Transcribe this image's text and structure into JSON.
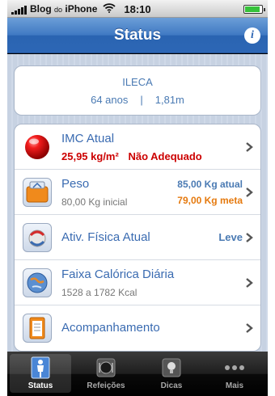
{
  "statusbar": {
    "carrier": "Blog",
    "carrier_small": "do",
    "carrier_rest": "iPhone",
    "time": "18:10",
    "battery_level": 0.9
  },
  "navbar": {
    "title": "Status",
    "info_label": "i"
  },
  "user": {
    "name": "ILECA",
    "age": "64 anos",
    "separator": "|",
    "height": "1,81m"
  },
  "rows": [
    {
      "title": "IMC Atual",
      "value": "25,95 kg/m²",
      "status": "Não Adequado",
      "status_color": "#cc0000",
      "value_color": "#cc0000"
    },
    {
      "title": "Peso",
      "sub": "80,00 Kg inicial",
      "current": "85,00 Kg atual",
      "goal": "79,00 Kg meta",
      "current_color": "#4a7ab3",
      "goal_color": "#e57a0f",
      "sub_color": "#777777"
    },
    {
      "title": "Ativ. Física Atual",
      "level": "Leve",
      "level_color": "#4a7ab3"
    },
    {
      "title": "Faixa Calórica Diária",
      "sub": "1528 a 1782 Kcal",
      "sub_color": "#777777"
    },
    {
      "title": "Acompanhamento"
    }
  ],
  "tabs": [
    {
      "label": "Status",
      "icon": "person-icon",
      "active": true
    },
    {
      "label": "Refeições",
      "icon": "plate-icon",
      "active": false
    },
    {
      "label": "Dicas",
      "icon": "lightbulb-icon",
      "active": false
    },
    {
      "label": "Mais",
      "icon": "more-dots-icon",
      "active": false
    }
  ],
  "colors": {
    "nav_blue": "#3f79c3",
    "title_blue": "#3a6bb1",
    "alert_red": "#cc0000",
    "goal_orange": "#e57a0f"
  }
}
